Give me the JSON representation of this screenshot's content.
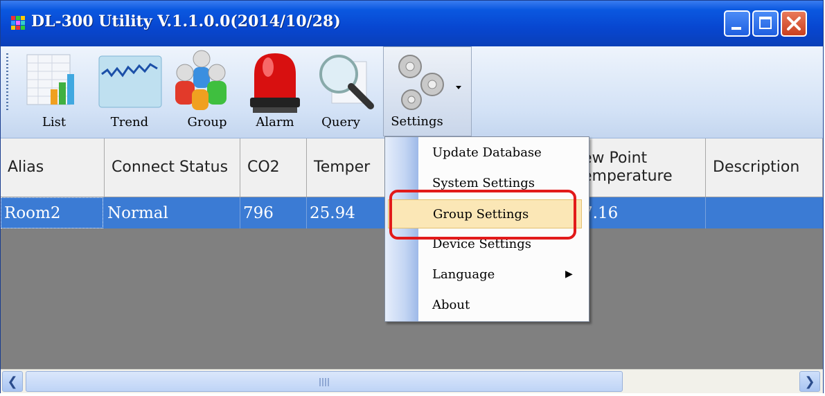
{
  "window": {
    "title": "DL-300 Utility V.1.1.0.0(2014/10/28)"
  },
  "toolbar": {
    "items": [
      {
        "label": "List"
      },
      {
        "label": "Trend"
      },
      {
        "label": "Group"
      },
      {
        "label": "Alarm"
      },
      {
        "label": "Query"
      },
      {
        "label": "Settings"
      }
    ]
  },
  "grid": {
    "headers": [
      "Alias",
      "Connect Status",
      "CO2",
      "Temper",
      "ew Point emperature",
      "Description"
    ],
    "rows": [
      {
        "alias": "Room2",
        "status": "Normal",
        "co2": "796",
        "temp": "25.94",
        "dew": "7.16",
        "desc": ""
      }
    ]
  },
  "menu": {
    "items": [
      {
        "label": "Update Database"
      },
      {
        "label": "System Settings"
      },
      {
        "label": "Group Settings"
      },
      {
        "label": "Device Settings"
      },
      {
        "label": "Language"
      },
      {
        "label": "About"
      }
    ],
    "highlighted": "Group Settings"
  },
  "colors": {
    "titlebar": "#0846d0",
    "row_selected": "#3b7bd4",
    "highlight": "#fbe7b6",
    "annotation": "#e21a1a"
  }
}
